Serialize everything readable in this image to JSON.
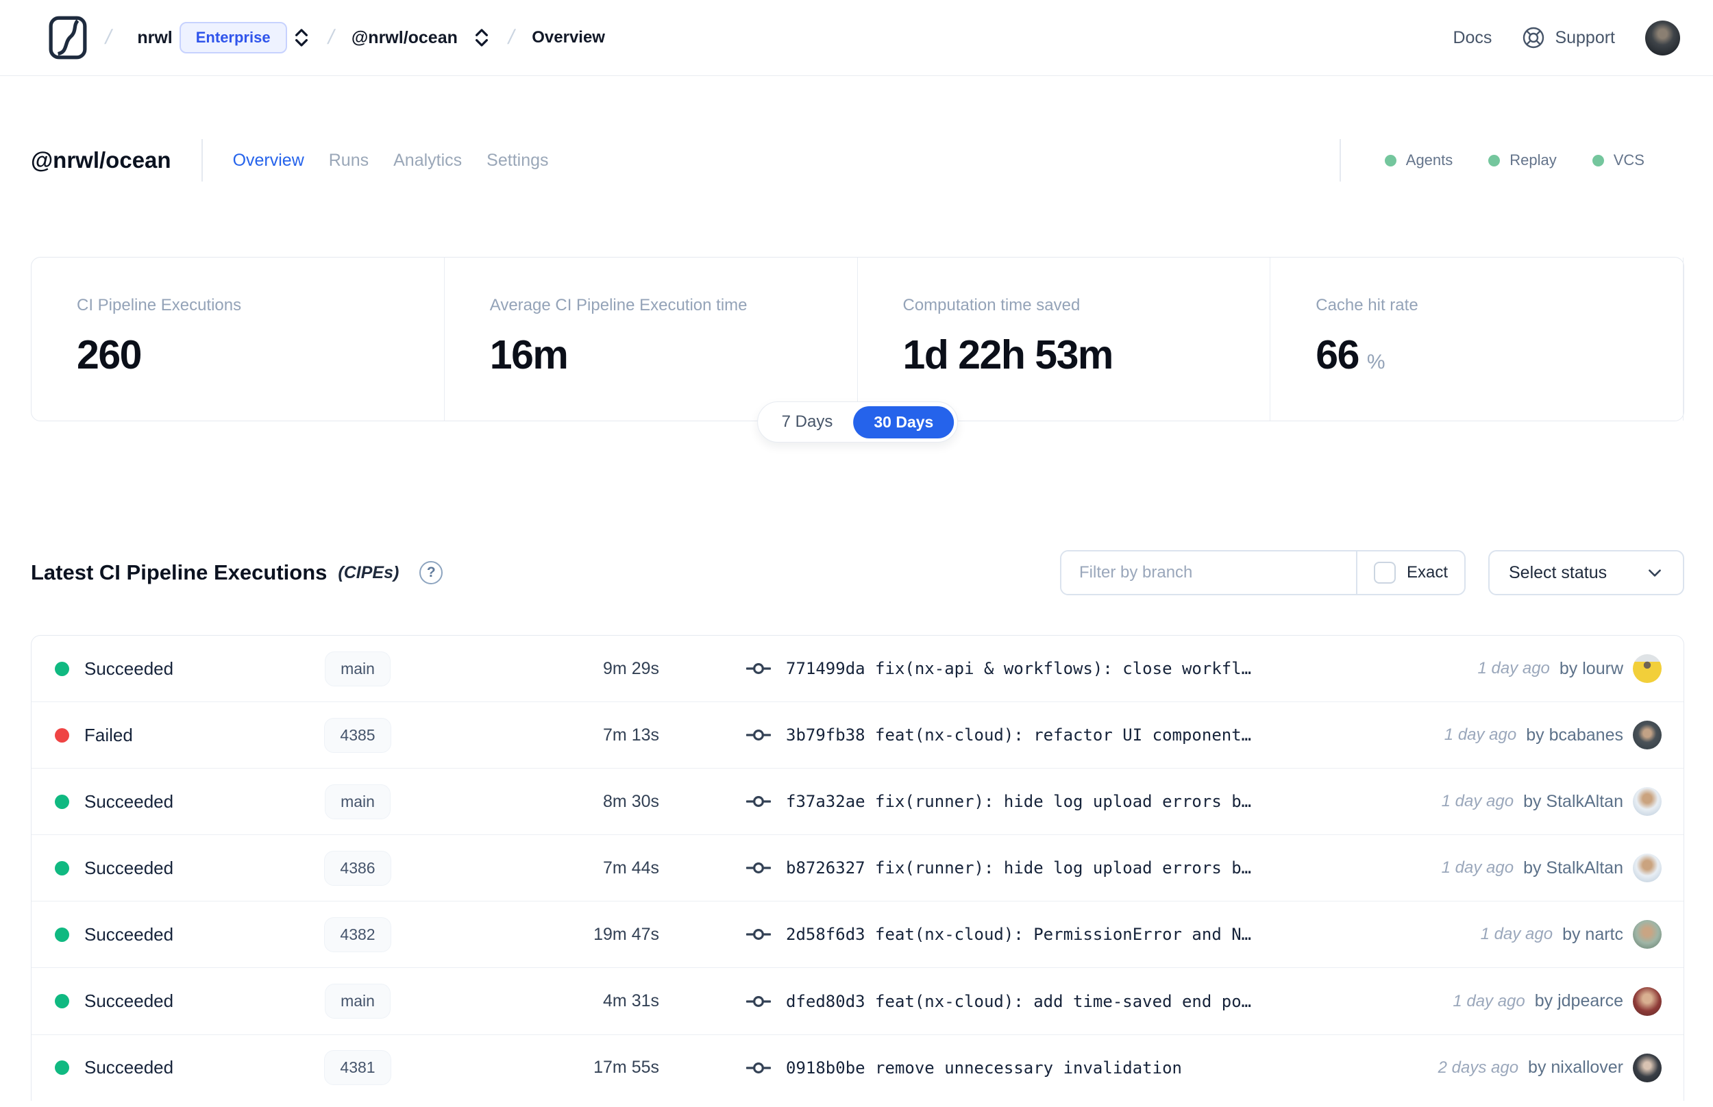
{
  "navbar": {
    "org": "nrwl",
    "org_badge": "Enterprise",
    "workspace": "@nrwl/ocean",
    "current_page": "Overview",
    "docs_label": "Docs",
    "support_label": "Support"
  },
  "header": {
    "title": "@nrwl/ocean",
    "tabs": [
      {
        "label": "Overview",
        "active": true
      },
      {
        "label": "Runs",
        "active": false
      },
      {
        "label": "Analytics",
        "active": false
      },
      {
        "label": "Settings",
        "active": false
      }
    ],
    "indicators": [
      {
        "label": "Agents"
      },
      {
        "label": "Replay"
      },
      {
        "label": "VCS"
      }
    ]
  },
  "stats": {
    "cards": [
      {
        "label": "CI Pipeline Executions",
        "value": "260",
        "suffix": ""
      },
      {
        "label": "Average CI Pipeline Execution time",
        "value": "16m",
        "suffix": ""
      },
      {
        "label": "Computation time saved",
        "value": "1d 22h 53m",
        "suffix": ""
      },
      {
        "label": "Cache hit rate",
        "value": "66",
        "suffix": "%"
      }
    ],
    "range_toggle": {
      "options": [
        "7 Days",
        "30 Days"
      ],
      "selected": "30 Days"
    }
  },
  "cipe_section": {
    "title": "Latest CI Pipeline Executions",
    "subtitle": "(CIPEs)",
    "help_icon": "?",
    "filter_placeholder": "Filter by branch",
    "exact_label": "Exact",
    "status_select_label": "Select status",
    "rows": [
      {
        "status": "Succeeded",
        "branch": "main",
        "duration": "9m 29s",
        "commit": "771499da fix(nx-api & workflows): close workfl…",
        "time_ago": "1 day ago",
        "author": "by lourw"
      },
      {
        "status": "Failed",
        "branch": "4385",
        "duration": "7m 13s",
        "commit": "3b79fb38 feat(nx-cloud): refactor UI component…",
        "time_ago": "1 day ago",
        "author": "by bcabanes"
      },
      {
        "status": "Succeeded",
        "branch": "main",
        "duration": "8m 30s",
        "commit": "f37a32ae fix(runner): hide log upload errors b…",
        "time_ago": "1 day ago",
        "author": "by StalkAltan"
      },
      {
        "status": "Succeeded",
        "branch": "4386",
        "duration": "7m 44s",
        "commit": "b8726327 fix(runner): hide log upload errors b…",
        "time_ago": "1 day ago",
        "author": "by StalkAltan"
      },
      {
        "status": "Succeeded",
        "branch": "4382",
        "duration": "19m 47s",
        "commit": "2d58f6d3 feat(nx-cloud): PermissionError and N…",
        "time_ago": "1 day ago",
        "author": "by nartc"
      },
      {
        "status": "Succeeded",
        "branch": "main",
        "duration": "4m 31s",
        "commit": "dfed80d3 feat(nx-cloud): add time-saved end po…",
        "time_ago": "1 day ago",
        "author": "by jdpearce"
      },
      {
        "status": "Succeeded",
        "branch": "4381",
        "duration": "17m 55s",
        "commit": "0918b0be remove unnecessary invalidation",
        "time_ago": "2 days ago",
        "author": "by nixallover"
      }
    ]
  },
  "colors": {
    "accent_blue": "#2563eb",
    "badge_blue": "#2f54eb",
    "success_green": "#10b981",
    "failed_red": "#ef4444",
    "indicator_green": "#74c69d",
    "muted_text": "#94a3b8"
  }
}
